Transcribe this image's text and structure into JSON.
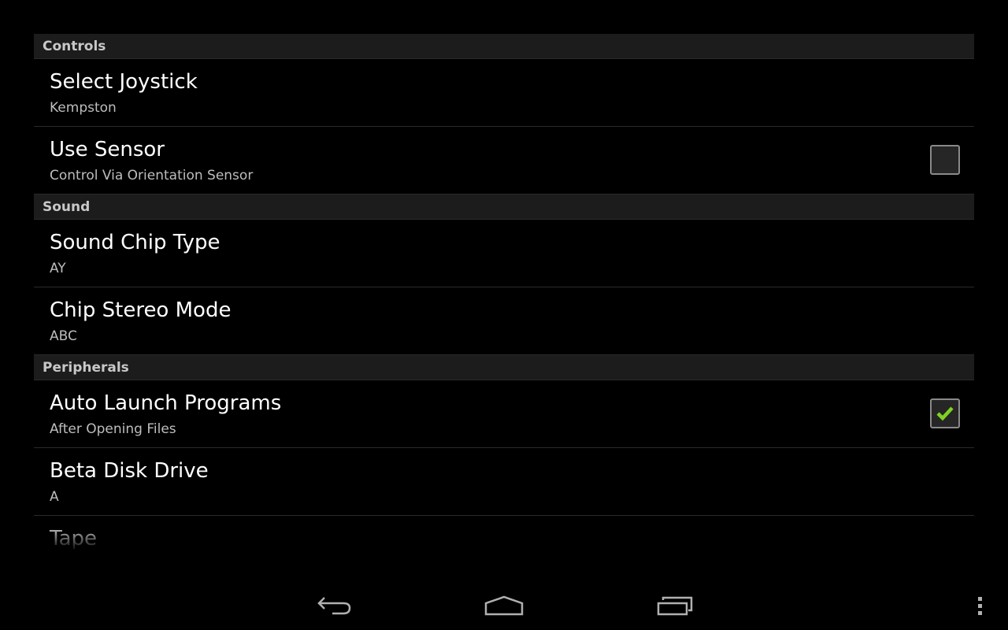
{
  "sections": [
    {
      "header": "Controls",
      "items": [
        {
          "title": "Select Joystick",
          "summary": "Kempston"
        },
        {
          "title": "Use Sensor",
          "summary": "Control Via Orientation Sensor",
          "checkbox": false
        }
      ]
    },
    {
      "header": "Sound",
      "items": [
        {
          "title": "Sound Chip Type",
          "summary": "AY"
        },
        {
          "title": "Chip Stereo Mode",
          "summary": "ABC"
        }
      ]
    },
    {
      "header": "Peripherals",
      "items": [
        {
          "title": "Auto Launch Programs",
          "summary": "After Opening Files",
          "checkbox": true
        },
        {
          "title": "Beta Disk Drive",
          "summary": "A"
        },
        {
          "title": "Tape",
          "summary": ""
        }
      ]
    }
  ],
  "colors": {
    "check": "#7fd321",
    "header_bg": "#1c1c1c"
  },
  "nav": {
    "icons": [
      "back-icon",
      "home-icon",
      "recent-apps-icon",
      "overflow-menu-icon"
    ]
  }
}
